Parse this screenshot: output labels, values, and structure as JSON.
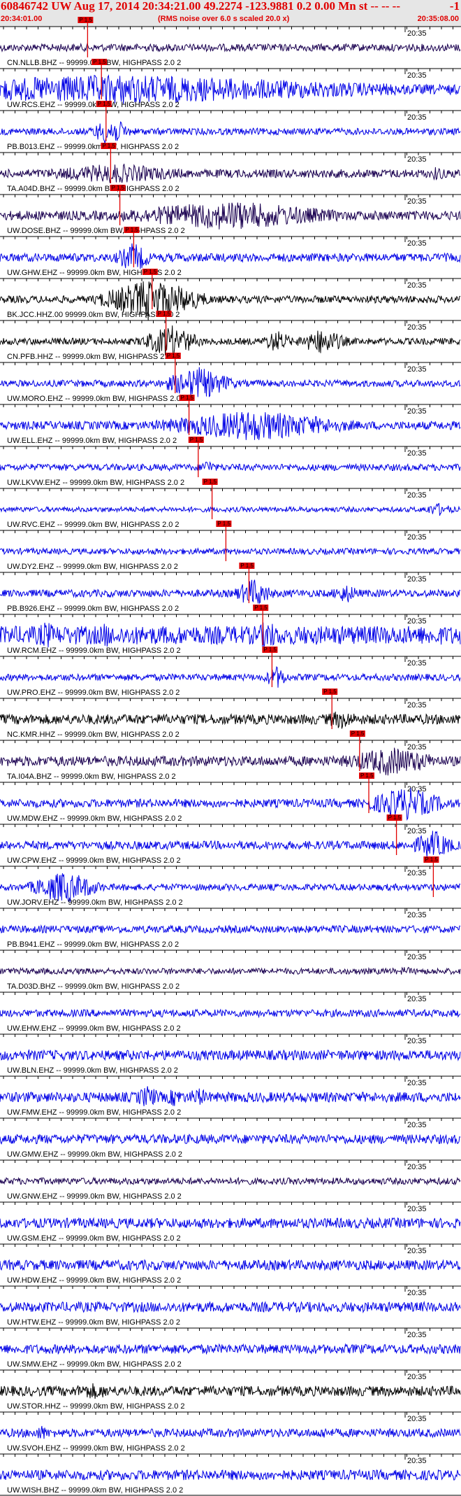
{
  "header": {
    "title": "60846742 UW Aug 17, 2014 20:34:21.00   49.2274 -123.9881  0.2 0.00 Mn st -- -- --",
    "right_mark": "-1",
    "start_time": "20:34:01.00",
    "end_time": "20:35:08.00",
    "note": "(RMS noise over 6.0 s scaled 20.0 x)"
  },
  "colors": {
    "blue": "#0000e6",
    "dark": "#1a0050",
    "black": "#000000",
    "red": "#e00000",
    "pick_box": "#e00000"
  },
  "minute_label": "20:35",
  "pick_tag": "P 1.5",
  "traces": [
    {
      "label": "CN.NLLB.BHZ -- 99999.0km BW, HIGHPASS  2.0  2",
      "color": "dark",
      "amp": 0.22,
      "pick": 0.19,
      "bursts": []
    },
    {
      "label": "UW.RCS.EHZ -- 99999.0km BW, HIGHPASS  2.0  2",
      "color": "blue",
      "amp": 0.3,
      "pick": 0.22,
      "bursts": [
        [
          0.26,
          0.95,
          0.9
        ]
      ]
    },
    {
      "label": "PB.B013.EHZ -- 99999.0km BW, HIGHPASS  2.0  2",
      "color": "blue",
      "amp": 0.2,
      "pick": 0.23,
      "bursts": [
        [
          0.24,
          0.05,
          0.9
        ]
      ]
    },
    {
      "label": "TA.A04D.BHZ -- 99999.0km BW, HIGHPASS  2.0  2",
      "color": "dark",
      "amp": 0.25,
      "pick": 0.24,
      "bursts": [
        [
          0.25,
          0.25,
          0.6
        ],
        [
          0.95,
          0.02,
          0.5
        ]
      ]
    },
    {
      "label": "UW.DOSE.BHZ -- 99999.0km BW, HIGHPASS  2.0  2",
      "color": "dark",
      "amp": 0.28,
      "pick": 0.26,
      "bursts": [
        [
          0.5,
          0.35,
          0.9
        ]
      ]
    },
    {
      "label": "UW.GHW.EHZ -- 99999.0km BW, HIGHPASS  2.0  2",
      "color": "blue",
      "amp": 0.25,
      "pick": 0.29,
      "bursts": [
        [
          0.29,
          0.05,
          0.9
        ]
      ]
    },
    {
      "label": "BK.JCC.HHZ.00 99999.0km BW, HIGHPASS  2.0  2",
      "color": "black",
      "amp": 0.22,
      "pick": 0.33,
      "bursts": [
        [
          0.33,
          0.15,
          1.3
        ]
      ]
    },
    {
      "label": "CN.PFB.HHZ -- 99999.0km BW, HIGHPASS  2.0  2",
      "color": "black",
      "amp": 0.2,
      "pick": 0.36,
      "bursts": [
        [
          0.37,
          0.08,
          1.0
        ],
        [
          0.6,
          0.04,
          0.7
        ],
        [
          0.7,
          0.07,
          0.8
        ]
      ]
    },
    {
      "label": "UW.MORO.EHZ -- 99999.0km BW, HIGHPASS  2.0  2",
      "color": "blue",
      "amp": 0.2,
      "pick": 0.38,
      "bursts": [
        [
          0.43,
          0.1,
          1.0
        ]
      ]
    },
    {
      "label": "UW.ELL.EHZ -- 99999.0km BW, HIGHPASS  2.0  2",
      "color": "blue",
      "amp": 0.25,
      "pick": 0.41,
      "bursts": [
        [
          0.55,
          0.3,
          0.95
        ]
      ]
    },
    {
      "label": "UW.LKVW.EHZ -- 99999.0km BW, HIGHPASS  2.0  2",
      "color": "blue",
      "amp": 0.2,
      "pick": 0.43,
      "bursts": [
        [
          0.45,
          0.02,
          0.5
        ]
      ]
    },
    {
      "label": "UW.RVC.EHZ -- 99999.0km BW, HIGHPASS  2.0  2",
      "color": "blue",
      "amp": 0.15,
      "pick": 0.46,
      "bursts": [
        [
          0.95,
          0.05,
          0.4
        ]
      ]
    },
    {
      "label": "UW.DY2.EHZ -- 99999.0km BW, HIGHPASS  2.0  2",
      "color": "blue",
      "amp": 0.18,
      "pick": 0.49,
      "bursts": []
    },
    {
      "label": "PB.B926.EHZ -- 99999.0km BW, HIGHPASS  2.0  2",
      "color": "blue",
      "amp": 0.22,
      "pick": 0.54,
      "bursts": [
        [
          0.55,
          0.05,
          0.9
        ],
        [
          0.75,
          0.04,
          0.6
        ]
      ]
    },
    {
      "label": "UW.RCM.EHZ -- 99999.0km BW, HIGHPASS  2.0  2",
      "color": "blue",
      "amp": 0.55,
      "pick": 0.57,
      "bursts": [
        [
          0.1,
          0.03,
          0.9
        ],
        [
          0.23,
          0.03,
          0.8
        ],
        [
          0.58,
          0.03,
          1.0
        ]
      ]
    },
    {
      "label": "UW.PRO.EHZ -- 99999.0km BW, HIGHPASS  2.0  2",
      "color": "blue",
      "amp": 0.2,
      "pick": 0.59,
      "bursts": [
        [
          0.6,
          0.03,
          0.7
        ]
      ]
    },
    {
      "label": "NC.KMR.HHZ -- 99999.0km BW, HIGHPASS  2.0  2",
      "color": "black",
      "amp": 0.3,
      "pick": 0.72,
      "bursts": [
        [
          0.74,
          0.06,
          0.6
        ]
      ]
    },
    {
      "label": "TA.I04A.BHZ -- 99999.0km BW, HIGHPASS  2.0  2",
      "color": "dark",
      "amp": 0.3,
      "pick": 0.78,
      "bursts": [
        [
          0.85,
          0.15,
          0.9
        ]
      ]
    },
    {
      "label": "UW.MDW.EHZ -- 99999.0km BW, HIGHPASS  2.0  2",
      "color": "blue",
      "amp": 0.25,
      "pick": 0.8,
      "bursts": [
        [
          0.88,
          0.12,
          1.0
        ]
      ]
    },
    {
      "label": "UW.CPW.EHZ -- 99999.0km BW, HIGHPASS  2.0  2",
      "color": "blue",
      "amp": 0.25,
      "pick": 0.86,
      "bursts": [
        [
          0.94,
          0.06,
          0.9
        ]
      ]
    },
    {
      "label": "UW.JORV.EHZ -- 99999.0km BW, HIGHPASS  2.0  2",
      "color": "blue",
      "amp": 0.2,
      "pick": 0.94,
      "bursts": [
        [
          0.14,
          0.1,
          1.0
        ]
      ]
    },
    {
      "label": "PB.B941.EHZ -- 99999.0km BW, HIGHPASS  2.0  2",
      "color": "blue",
      "amp": 0.22,
      "pick": null,
      "bursts": []
    },
    {
      "label": "TA.D03D.BHZ -- 99999.0km BW, HIGHPASS  2.0  2",
      "color": "dark",
      "amp": 0.18,
      "pick": null,
      "bursts": [
        [
          0.88,
          0.02,
          0.3
        ]
      ]
    },
    {
      "label": "UW.EHW.EHZ -- 99999.0km BW, HIGHPASS  2.0  2",
      "color": "blue",
      "amp": 0.22,
      "pick": null,
      "bursts": []
    },
    {
      "label": "UW.BLN.EHZ -- 99999.0km BW, HIGHPASS  2.0  2",
      "color": "blue",
      "amp": 0.3,
      "pick": null,
      "bursts": []
    },
    {
      "label": "UW.FMW.EHZ -- 99999.0km BW, HIGHPASS  2.0  2",
      "color": "blue",
      "amp": 0.3,
      "pick": null,
      "bursts": [
        [
          0.32,
          0.04,
          0.7
        ],
        [
          0.38,
          0.03,
          0.6
        ],
        [
          0.43,
          0.03,
          0.6
        ]
      ]
    },
    {
      "label": "UW.GMW.EHZ -- 99999.0km BW, HIGHPASS  2.0  2",
      "color": "blue",
      "amp": 0.28,
      "pick": null,
      "bursts": []
    },
    {
      "label": "UW.GNW.EHZ -- 99999.0km BW, HIGHPASS  2.0  2",
      "color": "dark",
      "amp": 0.2,
      "pick": null,
      "bursts": []
    },
    {
      "label": "UW.GSM.EHZ -- 99999.0km BW, HIGHPASS  2.0  2",
      "color": "blue",
      "amp": 0.3,
      "pick": null,
      "bursts": []
    },
    {
      "label": "UW.HDW.EHZ -- 99999.0km BW, HIGHPASS  2.0  2",
      "color": "blue",
      "amp": 0.3,
      "pick": null,
      "bursts": []
    },
    {
      "label": "UW.HTW.EHZ -- 99999.0km BW, HIGHPASS  2.0  2",
      "color": "blue",
      "amp": 0.3,
      "pick": null,
      "bursts": []
    },
    {
      "label": "UW.SMW.EHZ -- 99999.0km BW, HIGHPASS  2.0  2",
      "color": "blue",
      "amp": 0.28,
      "pick": null,
      "bursts": []
    },
    {
      "label": "UW.STOR.HHZ -- 99999.0km BW, HIGHPASS  2.0  2",
      "color": "black",
      "amp": 0.3,
      "pick": null,
      "bursts": [
        [
          0.2,
          0.1,
          0.5
        ]
      ]
    },
    {
      "label": "UW.SVOH.EHZ -- 99999.0km BW, HIGHPASS  2.0  2",
      "color": "blue",
      "amp": 0.25,
      "pick": null,
      "bursts": [
        [
          0.09,
          0.02,
          0.5
        ],
        [
          0.7,
          0.02,
          0.4
        ]
      ]
    },
    {
      "label": "UW.WISH.BHZ -- 99999.0km BW, HIGHPASS  2.0  2",
      "color": "blue",
      "amp": 0.3,
      "pick": null,
      "bursts": []
    }
  ]
}
